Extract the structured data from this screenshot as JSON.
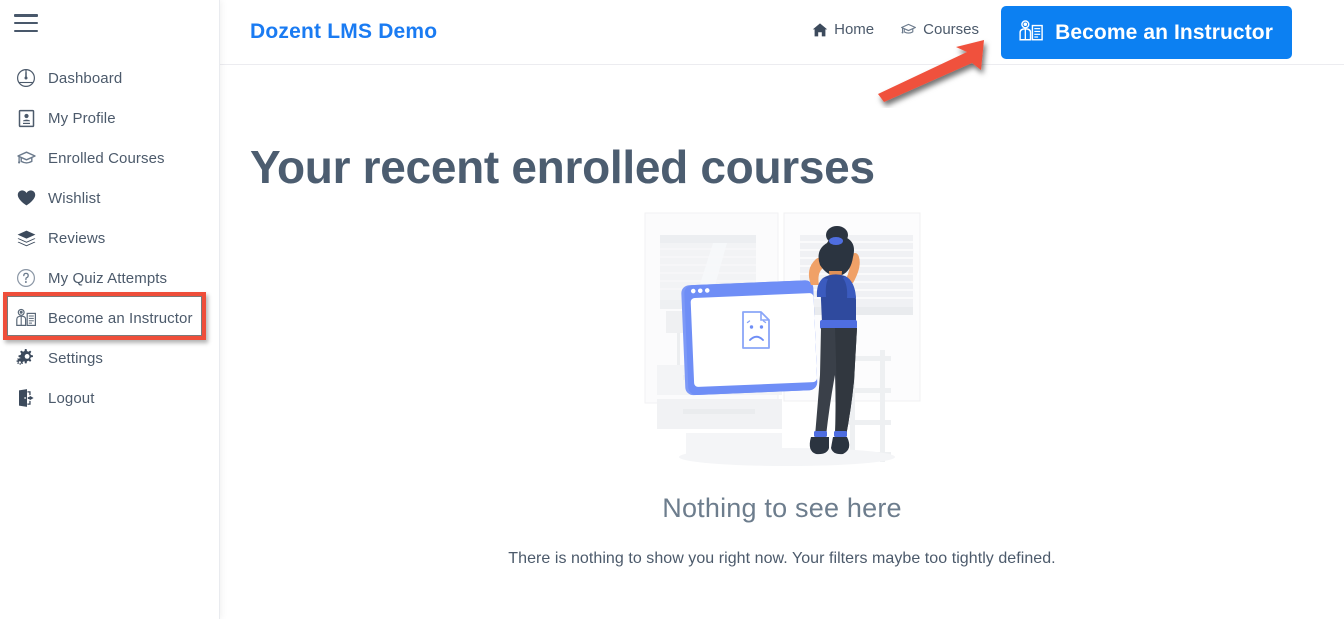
{
  "sidebar": {
    "menu_toggle": "hamburger-menu",
    "items": [
      {
        "label": "Dashboard",
        "icon": "dashboard-gauge-icon"
      },
      {
        "label": "My Profile",
        "icon": "id-card-icon"
      },
      {
        "label": "Enrolled Courses",
        "icon": "graduation-cap-icon"
      },
      {
        "label": "Wishlist",
        "icon": "heart-icon"
      },
      {
        "label": "Reviews",
        "icon": "layers-icon"
      },
      {
        "label": "My Quiz Attempts",
        "icon": "question-circle-icon"
      },
      {
        "label": "Become an Instructor",
        "icon": "instructor-board-icon"
      },
      {
        "label": "Settings",
        "icon": "gear-icon"
      },
      {
        "label": "Logout",
        "icon": "logout-door-icon"
      }
    ]
  },
  "header": {
    "site_title": "Dozent LMS Demo",
    "nav": [
      {
        "label": "Home",
        "icon": "home-icon"
      },
      {
        "label": "Courses",
        "icon": "graduation-cap-icon"
      }
    ],
    "cta_button": {
      "label": "Become an Instructor",
      "icon": "instructor-board-icon"
    }
  },
  "main": {
    "page_title": "Your recent enrolled courses",
    "empty_state": {
      "title": "Nothing to see here",
      "description": "There is nothing to show you right now. Your filters maybe too tightly defined.",
      "illustration": "woman-with-empty-browser-window-illustration"
    }
  },
  "annotations": {
    "arrow": "red-arrow-pointing-to-become-an-instructor-button",
    "highlight": "red-box-around-become-an-instructor-sidebar-item"
  },
  "colors": {
    "brand_blue": "#1a7bf2",
    "button_blue": "#0c80f2",
    "text_slate": "#4c5a6b",
    "heading_slate": "#4c5d70",
    "annotation_red": "#ef4e3a",
    "illustration_blue": "#5b7ef5"
  }
}
